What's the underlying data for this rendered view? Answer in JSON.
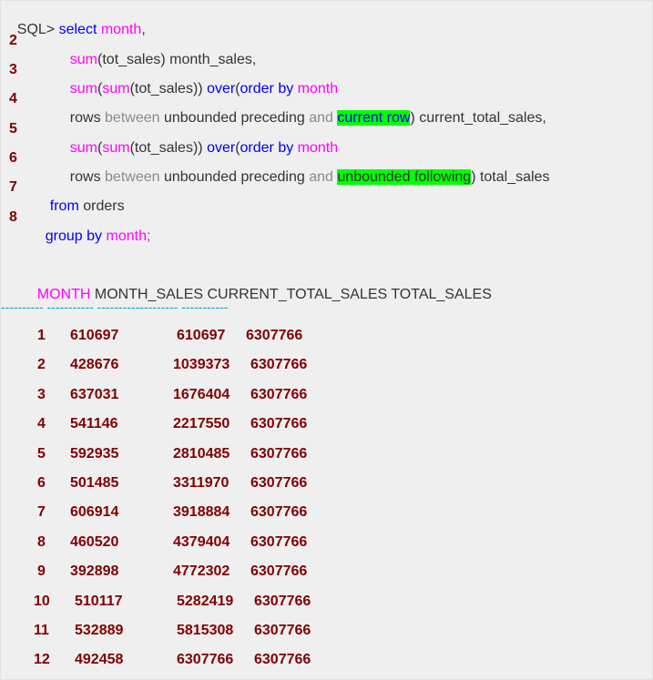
{
  "sql": {
    "prompt": "SQL>",
    "line1": {
      "kw_select": "select",
      "month": "month",
      "comma": ","
    },
    "line2": {
      "num": "2",
      "sum": "sum",
      "args": "(tot_sales) month_sales,"
    },
    "line3": {
      "num": "3",
      "sum1": "sum",
      "paren1": "(",
      "sum2": "sum",
      "args": "(tot_sales))",
      "over": "over",
      "paren2": "(",
      "order_by": "order by",
      "month": "month"
    },
    "line4": {
      "num": "4",
      "rows": "rows",
      "between": "between",
      "unbounded_preceding": "unbounded preceding",
      "and": "and",
      "highlight": "current row",
      "tail": ") current_total_sales,"
    },
    "line5": {
      "num": "5",
      "sum1": "sum",
      "paren1": "(",
      "sum2": "sum",
      "args": "(tot_sales))",
      "over": "over",
      "paren2": "(",
      "order_by": "order by",
      "month": "month"
    },
    "line6": {
      "num": "6",
      "rows": "rows",
      "between": "between",
      "unbounded_preceding": "unbounded preceding",
      "and": "and",
      "highlight": "unbounded following",
      "tail": ") total_sales"
    },
    "line7": {
      "num": "7",
      "from": "from",
      "table": "orders"
    },
    "line8": {
      "num": "8",
      "group_by": "group by",
      "month": "month",
      "semicolon": ";"
    }
  },
  "result": {
    "header_month": "MONTH",
    "header_rest": "MONTH_SALES CURRENT_TOTAL_SALES TOTAL_SALES",
    "separator": "---------- ----------- ------------------- -----------",
    "rows": [
      {
        "month": "1",
        "month_sales": "610697",
        "current_total": "610697",
        "total": "6307766"
      },
      {
        "month": "2",
        "month_sales": "428676",
        "current_total": "1039373",
        "total": "6307766"
      },
      {
        "month": "3",
        "month_sales": "637031",
        "current_total": "1676404",
        "total": "6307766"
      },
      {
        "month": "4",
        "month_sales": "541146",
        "current_total": "2217550",
        "total": "6307766"
      },
      {
        "month": "5",
        "month_sales": "592935",
        "current_total": "2810485",
        "total": "6307766"
      },
      {
        "month": "6",
        "month_sales": "501485",
        "current_total": "3311970",
        "total": "6307766"
      },
      {
        "month": "7",
        "month_sales": "606914",
        "current_total": "3918884",
        "total": "6307766"
      },
      {
        "month": "8",
        "month_sales": "460520",
        "current_total": "4379404",
        "total": "6307766"
      },
      {
        "month": "9",
        "month_sales": "392898",
        "current_total": "4772302",
        "total": "6307766"
      },
      {
        "month": "10",
        "month_sales": "510117",
        "current_total": "5282419",
        "total": "6307766"
      },
      {
        "month": "11",
        "month_sales": "532889",
        "current_total": "5815308",
        "total": "6307766"
      },
      {
        "month": "12",
        "month_sales": "492458",
        "current_total": "6307766",
        "total": "6307766"
      }
    ]
  },
  "colors": {
    "keyword": "#0000ee",
    "function": "#ff00ff",
    "plain": "#333333",
    "muted": "#8a8a8a",
    "highlight": "#00ff00",
    "result": "#800000",
    "separator": "#0aa3c2",
    "background": "#efefef"
  }
}
